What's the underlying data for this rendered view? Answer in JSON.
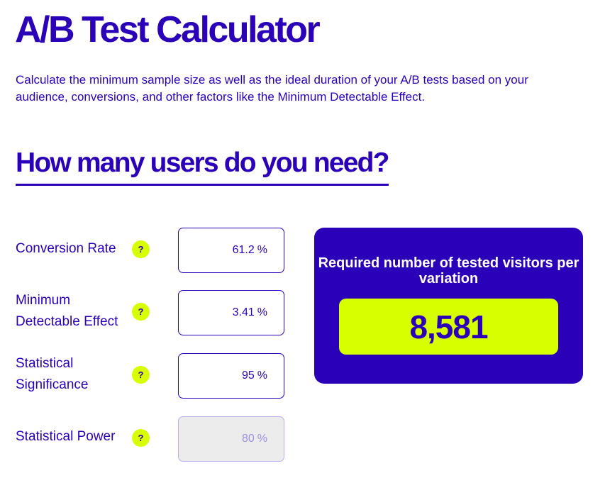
{
  "page": {
    "title": "A/B Test Calculator",
    "subtitle": "Calculate the minimum sample size as well as the ideal duration of your A/B tests based on your audience, conversions, and other factors like the Minimum Detectable Effect.",
    "section_title": "How many users do you need?"
  },
  "inputs": [
    {
      "label": "Conversion Rate",
      "help": "?",
      "value": "61.2",
      "unit": "%"
    },
    {
      "label": "Minimum Detectable Effect",
      "help": "?",
      "value": "3.41",
      "unit": "%"
    },
    {
      "label": "Statistical Significance",
      "help": "?",
      "value": "95",
      "unit": "%"
    },
    {
      "label": "Statistical Power",
      "help": "?",
      "value": "80",
      "unit": "%"
    }
  ],
  "result": {
    "label": "Required number of tested visitors per variation",
    "value": "8,581"
  },
  "colors": {
    "brand": "#2a00b8",
    "accent": "#d8ff00",
    "disabled_bg": "#ececec"
  }
}
